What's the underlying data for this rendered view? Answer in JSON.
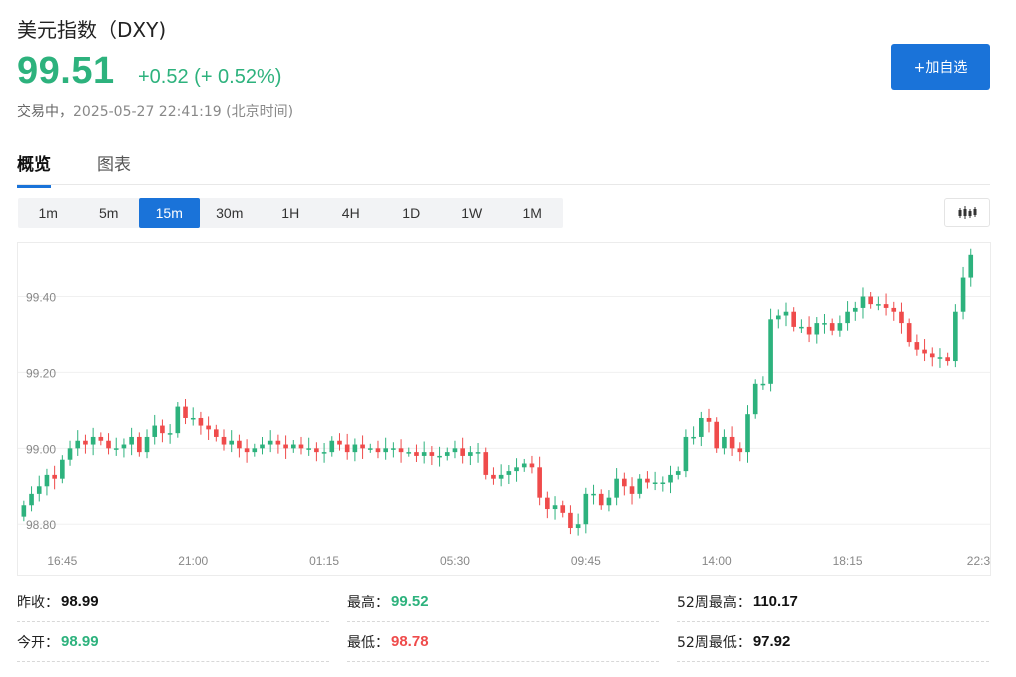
{
  "header": {
    "title": "美元指数（DXY)",
    "price": "99.51",
    "change": "+0.52 (+ 0.52%)",
    "status_label": "交易中，",
    "timestamp": "2025-05-27 22:41:19 (北京时间)",
    "add_watchlist_label": "+加自选"
  },
  "tabs": [
    {
      "label": "概览",
      "active": true
    },
    {
      "label": "图表",
      "active": false
    }
  ],
  "periods": [
    {
      "label": "1m",
      "active": false
    },
    {
      "label": "5m",
      "active": false
    },
    {
      "label": "15m",
      "active": true
    },
    {
      "label": "30m",
      "active": false
    },
    {
      "label": "1H",
      "active": false
    },
    {
      "label": "4H",
      "active": false
    },
    {
      "label": "1D",
      "active": false
    },
    {
      "label": "1W",
      "active": false
    },
    {
      "label": "1M",
      "active": false
    }
  ],
  "chart_type_icon": "candlestick-icon",
  "colors": {
    "accent": "#1a73d9",
    "up": "#2db27d",
    "down": "#ef4b4b"
  },
  "chart_data": {
    "type": "candlestick",
    "ylim": [
      98.74,
      99.52
    ],
    "y_ticks": [
      "99.40",
      "99.20",
      "99.00",
      "98.80"
    ],
    "y_tick_values": [
      99.4,
      99.2,
      99.0,
      98.8
    ],
    "x_ticks": [
      "16:45",
      "21:00",
      "01:15",
      "05:30",
      "09:45",
      "14:00",
      "18:15",
      "22:3"
    ],
    "x_tick_index": [
      5,
      22,
      39,
      56,
      73,
      90,
      107,
      124
    ],
    "closes": [
      98.85,
      98.88,
      98.9,
      98.93,
      98.92,
      98.97,
      99.0,
      99.02,
      99.01,
      99.03,
      99.02,
      99.0,
      99.0,
      99.01,
      99.03,
      98.99,
      99.03,
      99.06,
      99.04,
      99.04,
      99.11,
      99.08,
      99.08,
      99.06,
      99.05,
      99.03,
      99.01,
      99.02,
      99.0,
      98.99,
      99.0,
      99.01,
      99.02,
      99.01,
      99.0,
      99.01,
      99.0,
      99.0,
      98.99,
      98.99,
      99.02,
      99.01,
      98.99,
      99.01,
      99.0,
      99.0,
      98.99,
      99.0,
      99.0,
      98.99,
      98.99,
      98.98,
      98.99,
      98.98,
      98.98,
      98.99,
      99.0,
      98.98,
      98.99,
      98.99,
      98.93,
      98.92,
      98.93,
      98.94,
      98.95,
      98.96,
      98.95,
      98.87,
      98.84,
      98.85,
      98.83,
      98.79,
      98.8,
      98.88,
      98.88,
      98.85,
      98.87,
      98.92,
      98.9,
      98.88,
      98.92,
      98.91,
      98.91,
      98.91,
      98.93,
      98.94,
      99.03,
      99.03,
      99.08,
      99.07,
      99.0,
      99.03,
      99.0,
      98.99,
      99.09,
      99.17,
      99.17,
      99.34,
      99.35,
      99.36,
      99.32,
      99.32,
      99.3,
      99.33,
      99.33,
      99.31,
      99.33,
      99.36,
      99.37,
      99.4,
      99.38,
      99.38,
      99.37,
      99.36,
      99.33,
      99.28,
      99.26,
      99.25,
      99.24,
      99.24,
      99.23,
      99.36,
      99.45,
      99.51
    ],
    "x_count": 126
  },
  "stats": [
    {
      "label": "昨收：",
      "value": "98.99",
      "color": "dark"
    },
    {
      "label": "最高：",
      "value": "99.52",
      "color": "green"
    },
    {
      "label": "52周最高：",
      "value": "110.17",
      "color": "dark"
    },
    {
      "label": "今开：",
      "value": "98.99",
      "color": "green"
    },
    {
      "label": "最低：",
      "value": "98.78",
      "color": "red"
    },
    {
      "label": "52周最低：",
      "value": "97.92",
      "color": "dark"
    }
  ]
}
